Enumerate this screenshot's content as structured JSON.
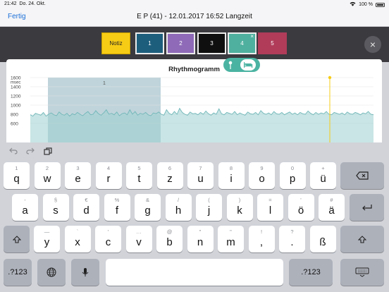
{
  "status": {
    "time": "21:42",
    "date": "Do. 24. Okt.",
    "battery": "100 %"
  },
  "nav": {
    "done_label": "Fertig",
    "title": "E P (41) - 12.01.2017 16:52 Langzeit"
  },
  "tabs": [
    {
      "label": "Notiz",
      "color": "#f7cc15"
    },
    {
      "label": "1",
      "color": "#1d5e7d"
    },
    {
      "label": "2",
      "color": "#8e6ab8"
    },
    {
      "label": "3",
      "color": "#0f0f10"
    },
    {
      "label": "4",
      "color": "#4fb09f",
      "close": "×"
    },
    {
      "label": "5",
      "color": "#b03c5a"
    }
  ],
  "close_glyph": "×",
  "chart_data": {
    "type": "area",
    "title": "Rhythmogramm",
    "ylabel": "msec",
    "y_ticks": [
      "1600",
      "1400",
      "1200",
      "1000",
      "800",
      "600"
    ],
    "ylim": [
      500,
      1700
    ],
    "series": [
      {
        "values": [
          790,
          760,
          820,
          800,
          780,
          840,
          760,
          800,
          830,
          790,
          770,
          850,
          800,
          780,
          820,
          760,
          810,
          790,
          840,
          800,
          770,
          820,
          860,
          790,
          800,
          880,
          810,
          780,
          830,
          900,
          800,
          820,
          790,
          850,
          770,
          810,
          830,
          790,
          900,
          800,
          860,
          780,
          820,
          800,
          840,
          790,
          770,
          830,
          810,
          850,
          800,
          780,
          900,
          820,
          790,
          860,
          800,
          930,
          840,
          800,
          780,
          850,
          810,
          820,
          790,
          840,
          800,
          870,
          810,
          780,
          830,
          800,
          920,
          810,
          790,
          840,
          820,
          800,
          860,
          790,
          830,
          800,
          780,
          850,
          810,
          800,
          840,
          790,
          880,
          820,
          800,
          830,
          790,
          860,
          810,
          800,
          840,
          790,
          820,
          850,
          800,
          830,
          790,
          840,
          810,
          800,
          870,
          820,
          790,
          840,
          800,
          830,
          810,
          860,
          800,
          790,
          840,
          820,
          800,
          830,
          790,
          850,
          810,
          800,
          840,
          820,
          790,
          830,
          810,
          860,
          800,
          790
        ]
      }
    ],
    "selection": {
      "label": "1"
    },
    "marker_color": "#f7cc15"
  },
  "keyboard": {
    "row1": [
      {
        "alt": "1",
        "main": "q"
      },
      {
        "alt": "2",
        "main": "w"
      },
      {
        "alt": "3",
        "main": "e"
      },
      {
        "alt": "4",
        "main": "r"
      },
      {
        "alt": "5",
        "main": "t"
      },
      {
        "alt": "6",
        "main": "z"
      },
      {
        "alt": "7",
        "main": "u"
      },
      {
        "alt": "8",
        "main": "i"
      },
      {
        "alt": "9",
        "main": "o"
      },
      {
        "alt": "0",
        "main": "p"
      },
      {
        "alt": "+",
        "main": "ü"
      }
    ],
    "row2": [
      {
        "alt": "-",
        "main": "a"
      },
      {
        "alt": "§",
        "main": "s"
      },
      {
        "alt": "€",
        "main": "d"
      },
      {
        "alt": "%",
        "main": "f"
      },
      {
        "alt": "&",
        "main": "g"
      },
      {
        "alt": "/",
        "main": "h"
      },
      {
        "alt": "(",
        "main": "j"
      },
      {
        "alt": ")",
        "main": "k"
      },
      {
        "alt": "=",
        "main": "l"
      },
      {
        "alt": "'",
        "main": "ö"
      },
      {
        "alt": "#",
        "main": "ä"
      }
    ],
    "row3": [
      {
        "alt": "—",
        "main": "y"
      },
      {
        "alt": "`",
        "main": "x"
      },
      {
        "alt": "'",
        "main": "c"
      },
      {
        "alt": "…",
        "main": "v"
      },
      {
        "alt": "@",
        "main": "b"
      },
      {
        "alt": "\"",
        "main": "n"
      },
      {
        "alt": "\"",
        "main": "m"
      },
      {
        "alt": "!",
        "main": ","
      },
      {
        "alt": "?",
        "main": "."
      },
      {
        "alt": "",
        "main": "ß"
      }
    ],
    "numbers_label": ".?123"
  }
}
